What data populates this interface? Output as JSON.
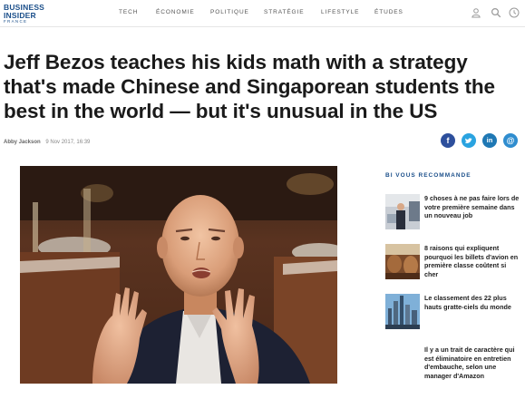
{
  "header": {
    "logo_line1": "BUSINESS",
    "logo_line2": "INSIDER",
    "logo_line3": "FRANCE",
    "nav": [
      "TECH",
      "ÉCONOMIE",
      "POLITIQUE",
      "STRATÉGIE",
      "LIFESTYLE",
      "ÉTUDES"
    ],
    "icons": [
      "user-icon",
      "search-icon",
      "menu-icon"
    ]
  },
  "article": {
    "title": "Jeff Bezos teaches his kids math with a strategy that's made Chinese and Singaporean students the best in the world — but it's unusual in the US",
    "author": "Abby Jackson",
    "date": "9 Nov 2017, 16:39",
    "share_icons": [
      "facebook-icon",
      "twitter-icon",
      "linkedin-icon",
      "email-icon"
    ]
  },
  "sidebar": {
    "title": "BI VOUS RECOMMANDE",
    "items": [
      {
        "text": "9 choses à ne pas faire lors de votre première semaine dans un nouveau job"
      },
      {
        "text": "8 raisons qui expliquent pourquoi les billets d'avion en première classe coûtent si cher"
      },
      {
        "text": "Le classement des 22 plus hauts gratte-ciels du monde"
      },
      {
        "text": "Il y a un trait de caractère qui est éliminatoire en entretien d'embauche, selon une manager d'Amazon"
      }
    ]
  },
  "colors": {
    "brand": "#1b4f8a",
    "facebook": "#2d4f9c",
    "twitter": "#2aa3e0",
    "linkedin": "#1f78b4",
    "email": "#2f8dcf"
  }
}
